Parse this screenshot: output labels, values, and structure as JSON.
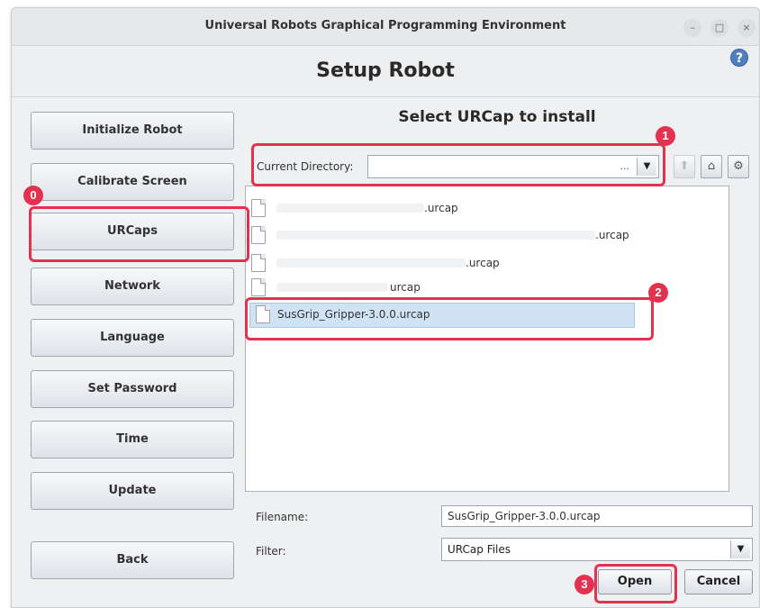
{
  "window": {
    "title": "Universal Robots Graphical Programming Environment",
    "controls": {
      "minimize": "–",
      "maximize": "□",
      "close": "×"
    }
  },
  "header": {
    "title": "Setup Robot",
    "help": "?"
  },
  "sidebar": {
    "items": [
      {
        "label": "Initialize Robot"
      },
      {
        "label": "Calibrate Screen"
      },
      {
        "label": "URCaps"
      },
      {
        "label": "Network"
      },
      {
        "label": "Language"
      },
      {
        "label": "Set Password"
      },
      {
        "label": "Time"
      },
      {
        "label": "Update"
      },
      {
        "label": "Back"
      }
    ]
  },
  "chooser": {
    "title": "Select URCap to install",
    "current_directory_label": "Current Directory:",
    "current_directory_value": "",
    "ellipsis": "...",
    "toolbar_icons": [
      "up-folder-icon",
      "home-icon",
      "gear-icon"
    ],
    "files": [
      {
        "name": ".urcap"
      },
      {
        "name": ".urcap"
      },
      {
        "name": ".urcap"
      },
      {
        "name": "urcap"
      },
      {
        "name": "SusGrip_Gripper-3.0.0.urcap"
      }
    ],
    "filename_label": "Filename:",
    "filename_value": "SusGrip_Gripper-3.0.0.urcap",
    "filter_label": "Filter:",
    "filter_value": "URCap Files",
    "open_label": "Open",
    "cancel_label": "Cancel"
  },
  "annotations": {
    "step0": "0",
    "step1": "1",
    "step2": "2",
    "step3": "3",
    "color": "#e2324f"
  }
}
